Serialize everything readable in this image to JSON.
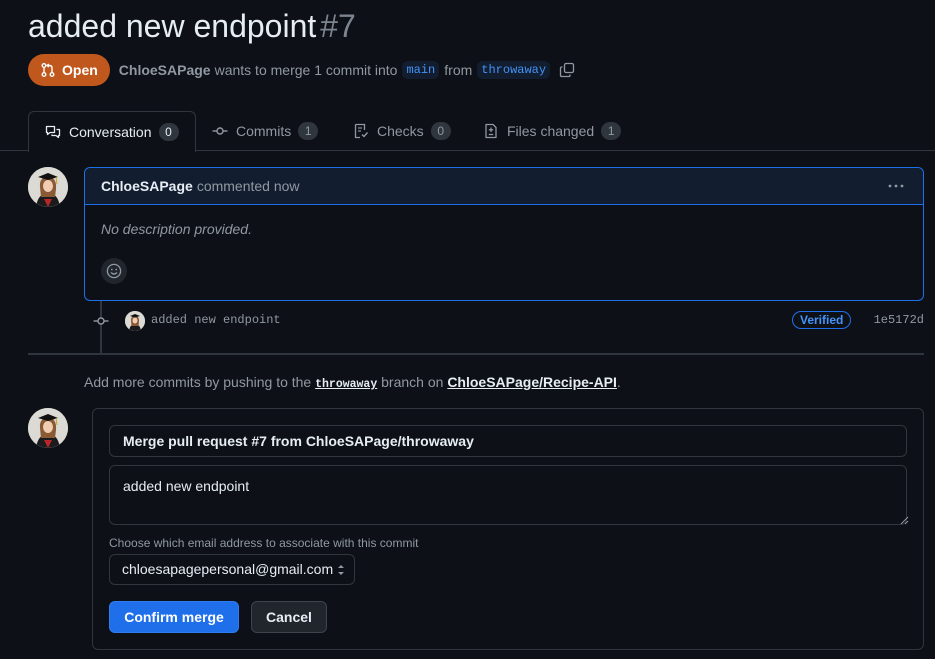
{
  "pr": {
    "title": "added new endpoint",
    "number": "#7",
    "state": "Open",
    "author": "ChloeSAPage",
    "merge_text_pre": "wants to merge 1 commit into",
    "base_branch": "main",
    "from_text": "from",
    "head_branch": "throwaway"
  },
  "tabs": [
    {
      "label": "Conversation",
      "count": "0",
      "icon": "comment-discussion-icon"
    },
    {
      "label": "Commits",
      "count": "1",
      "icon": "git-commit-icon"
    },
    {
      "label": "Checks",
      "count": "0",
      "icon": "checklist-icon"
    },
    {
      "label": "Files changed",
      "count": "1",
      "icon": "file-diff-icon"
    }
  ],
  "comment": {
    "author": "ChloeSAPage",
    "time": "commented now",
    "body": "No description provided.",
    "menu_icon": "kebab-horizontal-icon",
    "reaction_icon": "smiley-icon"
  },
  "commit": {
    "message": "added new endpoint",
    "badge": "Verified",
    "sha": "1e5172d"
  },
  "push_hint": {
    "pre": "Add more commits by pushing to the",
    "branch": "throwaway",
    "mid": "branch on",
    "repo": "ChloeSAPage/Recipe-API",
    "post": "."
  },
  "merge": {
    "title_value": "Merge pull request #7 from ChloeSAPage/throwaway",
    "description_value": "added new endpoint",
    "email_label": "Choose which email address to associate with this commit",
    "email_value": "chloesapagepersonal@gmail.com",
    "confirm_label": "Confirm merge",
    "cancel_label": "Cancel"
  },
  "colors": {
    "background": "#0d1117",
    "open_badge": "#c0581d",
    "accent": "#1f6feb",
    "link": "#4493f8"
  }
}
